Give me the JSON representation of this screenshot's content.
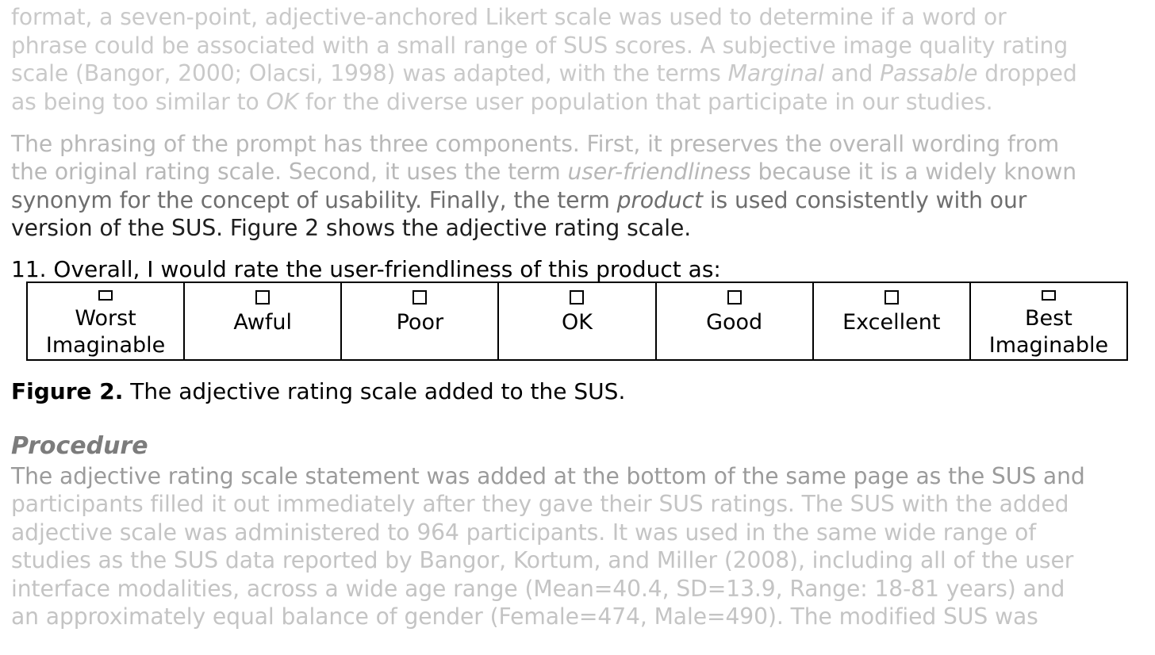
{
  "paragraph1": {
    "lines": [
      {
        "parts": [
          {
            "text": "format, a seven-point, adjective-anchored Likert scale was used to determine if a word or"
          }
        ]
      },
      {
        "parts": [
          {
            "text": "phrase could be associated with a small range of SUS scores. A subjective image quality rating"
          }
        ]
      },
      {
        "parts": [
          {
            "text": "scale (Bangor, 2000; Olacsi, 1998) was adapted, with the terms "
          },
          {
            "text": "Marginal",
            "italic": true
          },
          {
            "text": " and "
          },
          {
            "text": "Passable",
            "italic": true
          },
          {
            "text": " dropped"
          }
        ]
      },
      {
        "parts": [
          {
            "text": "as being too similar to "
          },
          {
            "text": "OK",
            "italic": true
          },
          {
            "text": " for the diverse user population that participate in our studies."
          }
        ]
      }
    ]
  },
  "paragraph2": {
    "lines": [
      {
        "parts": [
          {
            "text": "The phrasing of the prompt has three components. First, it preserves the overall wording from"
          }
        ]
      },
      {
        "parts": [
          {
            "text": "the original rating scale. Second, it uses the term "
          },
          {
            "text": "user-friendliness",
            "italic": true
          },
          {
            "text": " because it is a widely known"
          }
        ]
      },
      {
        "parts": [
          {
            "text": "synonym for the concept of usability. Finally, the term "
          },
          {
            "text": "product",
            "italic": true
          },
          {
            "text": " is used consistently with our"
          }
        ]
      },
      {
        "parts": [
          {
            "text": "version of the SUS. Figure 2 shows the adjective rating scale."
          }
        ]
      }
    ]
  },
  "figure": {
    "question": "11. Overall, I would rate the user-friendliness of this product as:",
    "options": [
      {
        "label": "Worst\nImaginable",
        "checked": false
      },
      {
        "label": "Awful",
        "checked": false
      },
      {
        "label": "Poor",
        "checked": false
      },
      {
        "label": "OK",
        "checked": false
      },
      {
        "label": "Good",
        "checked": false
      },
      {
        "label": "Excellent",
        "checked": false
      },
      {
        "label": "Best\nImaginable",
        "checked": false
      }
    ],
    "caption_label": "Figure 2.",
    "caption_text": " The adjective rating scale added to the SUS."
  },
  "procedure": {
    "heading": "Procedure",
    "lines": [
      {
        "parts": [
          {
            "text": "The adjective rating scale statement was added at the bottom of the same page as the SUS and"
          }
        ]
      },
      {
        "parts": [
          {
            "text": "participants filled it out immediately after they gave their SUS ratings. The SUS with the added"
          }
        ]
      },
      {
        "parts": [
          {
            "text": "adjective scale was administered to 964 participants. It was used in the same wide range of"
          }
        ]
      },
      {
        "parts": [
          {
            "text": "studies as the SUS data reported by Bangor, Kortum, and Miller (2008), including all of the user"
          }
        ]
      },
      {
        "parts": [
          {
            "text": "interface modalities, across a wide age range (Mean=40.4, SD=13.9, Range: 18-81 years) and"
          }
        ]
      },
      {
        "parts": [
          {
            "text": "an approximately equal balance of gender (Female=474, Male=490). The modified SUS was"
          }
        ]
      }
    ]
  }
}
